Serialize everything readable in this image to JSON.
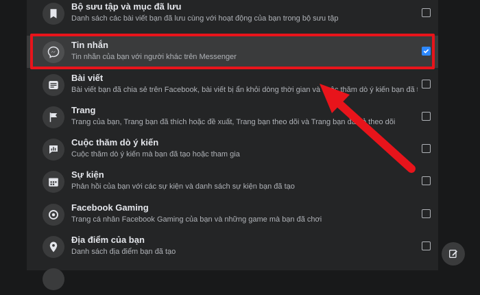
{
  "items": [
    {
      "title": "Bộ sưu tập và mục đã lưu",
      "desc": "Danh sách các bài viết bạn đã lưu cùng với hoạt động của bạn trong bộ sưu tập",
      "checked": false,
      "icon": "bookmark-icon"
    },
    {
      "title": "Tin nhắn",
      "desc": "Tin nhắn của bạn với người khác trên Messenger",
      "checked": true,
      "icon": "messenger-icon"
    },
    {
      "title": "Bài viết",
      "desc": "Bài viết bạn đã chia sẻ trên Facebook, bài viết bị ẩn khỏi dòng thời gian và cuộc thăm dò ý kiến bạn đã tạo",
      "checked": false,
      "icon": "post-icon"
    },
    {
      "title": "Trang",
      "desc": "Trang của bạn, Trang bạn đã thích hoặc đề xuất, Trang bạn theo dõi và Trang bạn đã bỏ theo dõi",
      "checked": false,
      "icon": "flag-icon"
    },
    {
      "title": "Cuộc thăm dò ý kiến",
      "desc": "Cuộc thăm dò ý kiến mà bạn đã tạo hoặc tham gia",
      "checked": false,
      "icon": "poll-icon"
    },
    {
      "title": "Sự kiện",
      "desc": "Phản hồi của bạn với các sự kiện và danh sách sự kiện bạn đã tạo",
      "checked": false,
      "icon": "calendar-icon"
    },
    {
      "title": "Facebook Gaming",
      "desc": "Trang cá nhân Facebook Gaming của bạn và những game mà bạn đã chơi",
      "checked": false,
      "icon": "gaming-icon"
    },
    {
      "title": "Địa điểm của bạn",
      "desc": "Danh sách địa điểm bạn đã tạo",
      "checked": false,
      "icon": "location-icon"
    }
  ],
  "colors": {
    "accent": "#2d88ff",
    "highlight": "#e8141b",
    "panel": "#242526"
  }
}
